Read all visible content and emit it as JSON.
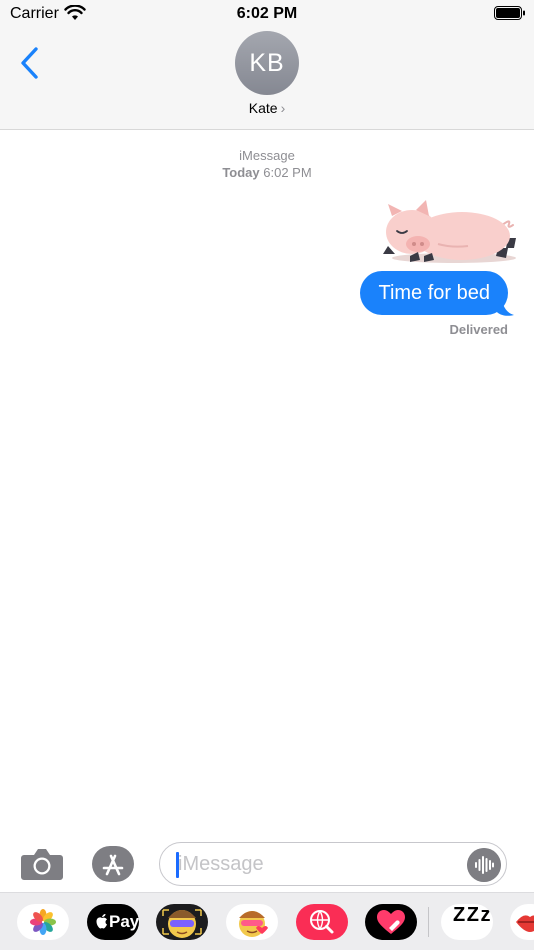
{
  "status_bar": {
    "carrier": "Carrier",
    "time": "6:02 PM"
  },
  "header": {
    "avatar_initials": "KB",
    "contact_name": "Kate",
    "contact_chevron": "›"
  },
  "thread": {
    "service": "iMessage",
    "timestamp_day": "Today",
    "timestamp_time": "6:02 PM",
    "messages": [
      {
        "type": "sticker",
        "sticker_name": "sleeping-pig"
      },
      {
        "type": "text",
        "text": "Time for bed",
        "from": "me"
      }
    ],
    "delivery_status": "Delivered"
  },
  "compose": {
    "placeholder": "iMessage"
  },
  "app_drawer": {
    "items": [
      {
        "name": "photos-app-icon"
      },
      {
        "name": "apple-pay-app-icon",
        "label": "Pay"
      },
      {
        "name": "memoji-app-icon"
      },
      {
        "name": "memoji-stickers-app-icon"
      },
      {
        "name": "web-images-app-icon"
      },
      {
        "name": "digital-touch-app-icon"
      },
      {
        "name": "zzz-sticker-app-icon",
        "label": "Z Z z"
      },
      {
        "name": "lips-sticker-app-icon"
      }
    ]
  },
  "colors": {
    "accent": "#1a82fb",
    "bubble": "#1a82fb",
    "secondary_text": "#8e8e93"
  }
}
